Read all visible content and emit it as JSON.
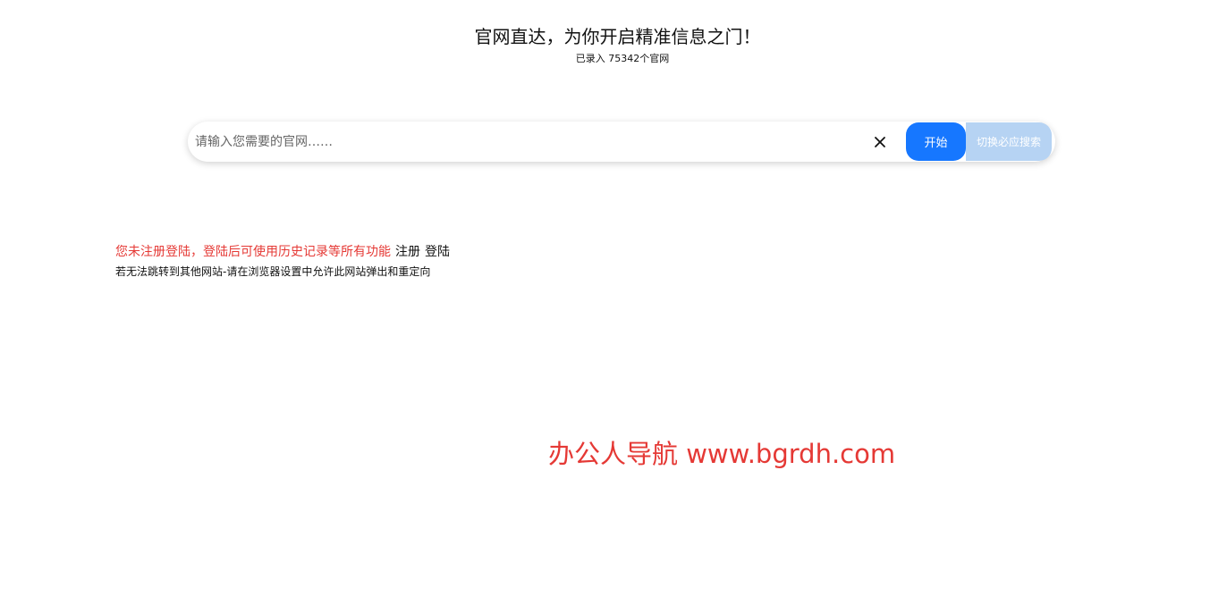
{
  "header": {
    "title": "官网直达，为你开启精准信息之门！",
    "subtitle": "已录入 75342个官网"
  },
  "search": {
    "placeholder": "请输入您需要的官网……",
    "value": "",
    "clear_icon": "close-icon",
    "start_label": "开始",
    "switch_label": "切换必应搜索",
    "colors": {
      "start": "#1677ff",
      "switch": "#b6d3f3"
    }
  },
  "notice": {
    "message": "您未注册登陆，登陆后可使用历史记录等所有功能",
    "register_label": "注册",
    "login_label": "登陆",
    "popup_hint": "若无法跳转到其他网站-请在浏览器设置中允许此网站弹出和重定向",
    "message_color": "#e53935"
  },
  "watermark": {
    "text": "办公人导航 www.bgrdh.com",
    "color": "#e53935"
  }
}
